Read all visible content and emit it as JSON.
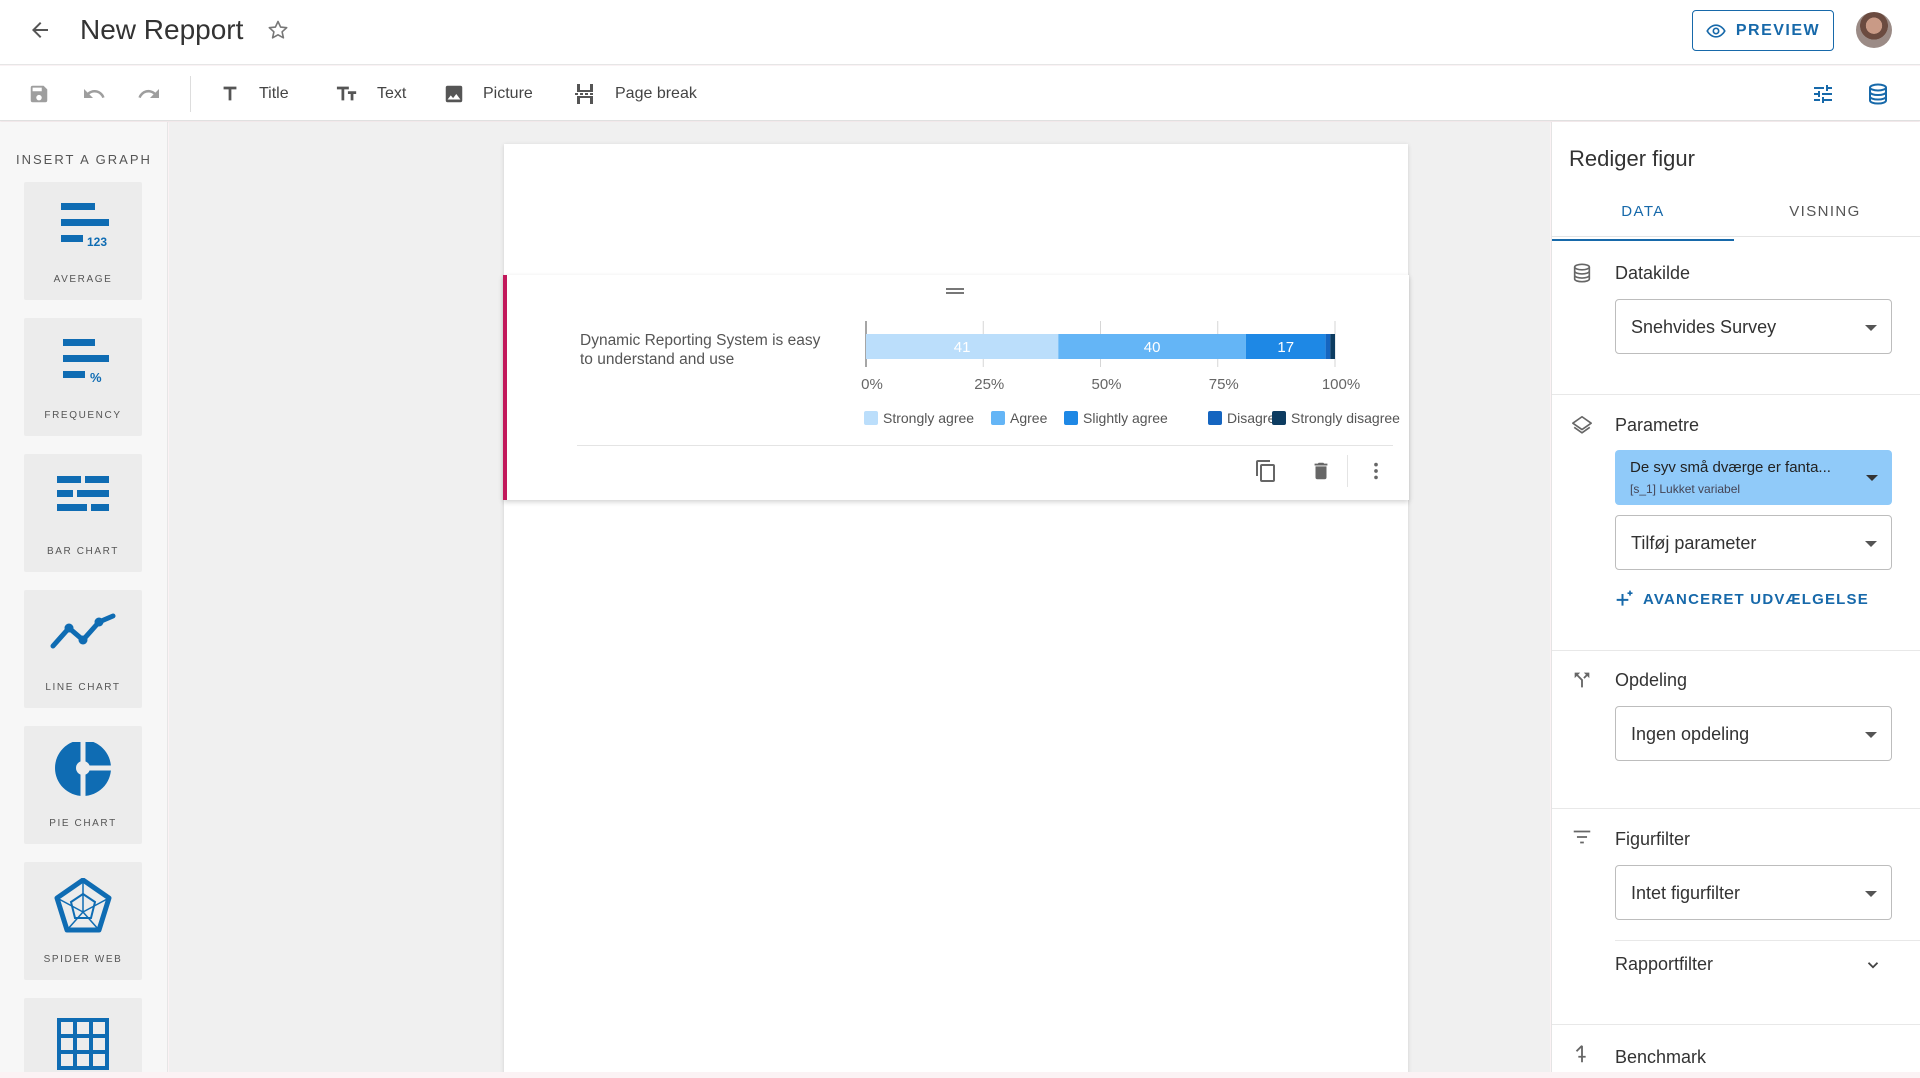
{
  "header": {
    "title": "New Repport",
    "preview_label": "PREVIEW"
  },
  "toolbar": {
    "items": [
      {
        "label": "Title",
        "icon": "title-icon"
      },
      {
        "label": "Text",
        "icon": "text-size-icon"
      },
      {
        "label": "Picture",
        "icon": "image-icon"
      },
      {
        "label": "Page break",
        "icon": "page-break-icon"
      }
    ]
  },
  "palette": {
    "heading": "INSERT A GRAPH",
    "cards": [
      {
        "label": "AVERAGE",
        "icon": "average-icon"
      },
      {
        "label": "FREQUENCY",
        "icon": "frequency-icon"
      },
      {
        "label": "BAR CHART",
        "icon": "bar-chart-icon"
      },
      {
        "label": "LINE CHART",
        "icon": "line-chart-icon"
      },
      {
        "label": "PIE CHART",
        "icon": "pie-chart-icon"
      },
      {
        "label": "SPIDER WEB",
        "icon": "spider-web-icon"
      },
      {
        "label": "",
        "icon": "table-grid-icon"
      }
    ]
  },
  "chart_data": {
    "type": "bar",
    "orientation": "horizontal-stacked",
    "categories": [
      "Dynamic Reporting System is easy to understand and use"
    ],
    "category_lines": [
      "Dynamic Reporting System is easy",
      "to understand and use"
    ],
    "series": [
      {
        "name": "Strongly agree",
        "values": [
          41
        ],
        "color": "#bbdefb"
      },
      {
        "name": "Agree",
        "values": [
          40
        ],
        "color": "#64b5f6"
      },
      {
        "name": "Slightly agree",
        "values": [
          17
        ],
        "color": "#1e88e5"
      },
      {
        "name": "Disagree",
        "values": [
          1
        ],
        "color": "#1565c0"
      },
      {
        "name": "Strongly disagree",
        "values": [
          1
        ],
        "color": "#0d3c61"
      }
    ],
    "data_labels": [
      "41",
      "40",
      "17",
      "",
      ""
    ],
    "x_ticks": [
      "0%",
      "25%",
      "50%",
      "75%",
      "100%"
    ],
    "xlim": [
      0,
      100
    ],
    "legend": "bottom"
  },
  "panel": {
    "title": "Rediger figur",
    "tabs": [
      "DATA",
      "VISNING"
    ],
    "active_tab": "DATA",
    "datakilde": {
      "label": "Datakilde",
      "value": "Snehvides Survey"
    },
    "parametre": {
      "label": "Parametre",
      "chip_title": "De syv små dværge er fanta...",
      "chip_sub": "[s_1] Lukket variabel",
      "add_placeholder": "Tilføj parameter",
      "advanced_label": "AVANCERET UDVÆLGELSE"
    },
    "opdeling": {
      "label": "Opdeling",
      "value": "Ingen opdeling"
    },
    "figurfilter": {
      "label": "Figurfilter",
      "value": "Intet figurfilter"
    },
    "rapportfilter": {
      "label": "Rapportfilter"
    },
    "benchmark": {
      "label": "Benchmark"
    }
  },
  "colors": {
    "accent": "#1769aa",
    "figure_marker": "#c2185b",
    "icon_blue": "#0f6cb3"
  }
}
